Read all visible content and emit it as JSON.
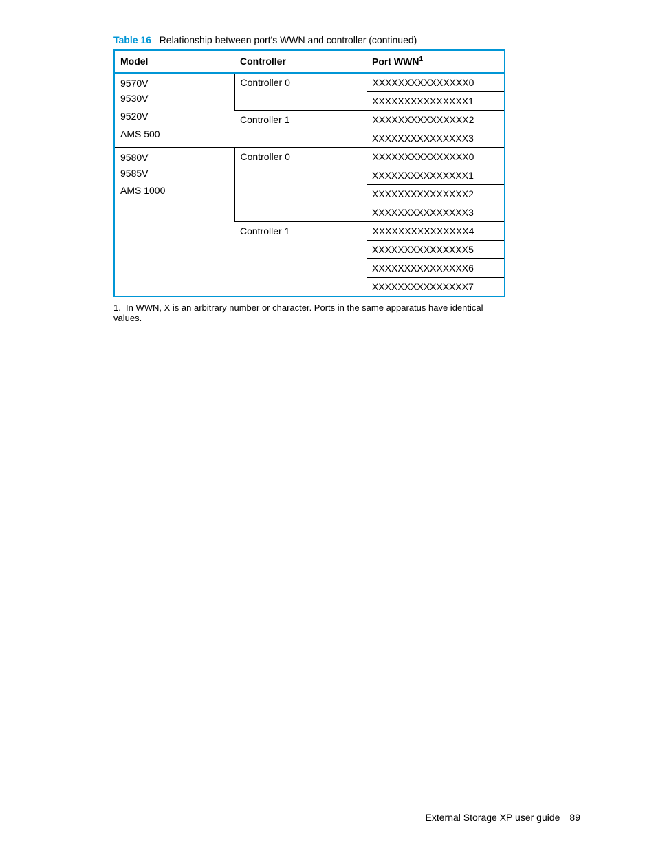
{
  "caption": {
    "prefix": "Table 16",
    "text": "Relationship between port's WWN and controller (continued)"
  },
  "headers": {
    "model": "Model",
    "controller": "Controller",
    "port_wwn": "Port WWN",
    "sup": "1"
  },
  "rows": [
    {
      "models": [
        "9570V",
        "9530V",
        "9520V",
        "AMS 500"
      ],
      "ctrl": "Controller 0",
      "wwn": "XXXXXXXXXXXXXXX0",
      "m_rs": 4,
      "c_rs": 2
    },
    {
      "wwn": "XXXXXXXXXXXXXXX1"
    },
    {
      "ctrl": "Controller 1",
      "wwn": "XXXXXXXXXXXXXXX2",
      "c_rs": 2
    },
    {
      "wwn": "XXXXXXXXXXXXXXX3"
    },
    {
      "models": [
        "9580V",
        "9585V",
        "AMS 1000"
      ],
      "ctrl": "Controller 0",
      "wwn": "XXXXXXXXXXXXXXX0",
      "m_rs": 8,
      "c_rs": 4
    },
    {
      "wwn": "XXXXXXXXXXXXXXX1"
    },
    {
      "wwn": "XXXXXXXXXXXXXXX2"
    },
    {
      "wwn": "XXXXXXXXXXXXXXX3"
    },
    {
      "ctrl": "Controller 1",
      "wwn": "XXXXXXXXXXXXXXX4",
      "c_rs": 4
    },
    {
      "wwn": "XXXXXXXXXXXXXXX5"
    },
    {
      "wwn": "XXXXXXXXXXXXXXX6"
    },
    {
      "wwn": "XXXXXXXXXXXXXXX7"
    }
  ],
  "footnote": {
    "num": "1.",
    "text": "In WWN, X is an arbitrary number or character. Ports in the same apparatus have identical values."
  },
  "footer": {
    "title": "External Storage XP user guide",
    "page": "89"
  }
}
